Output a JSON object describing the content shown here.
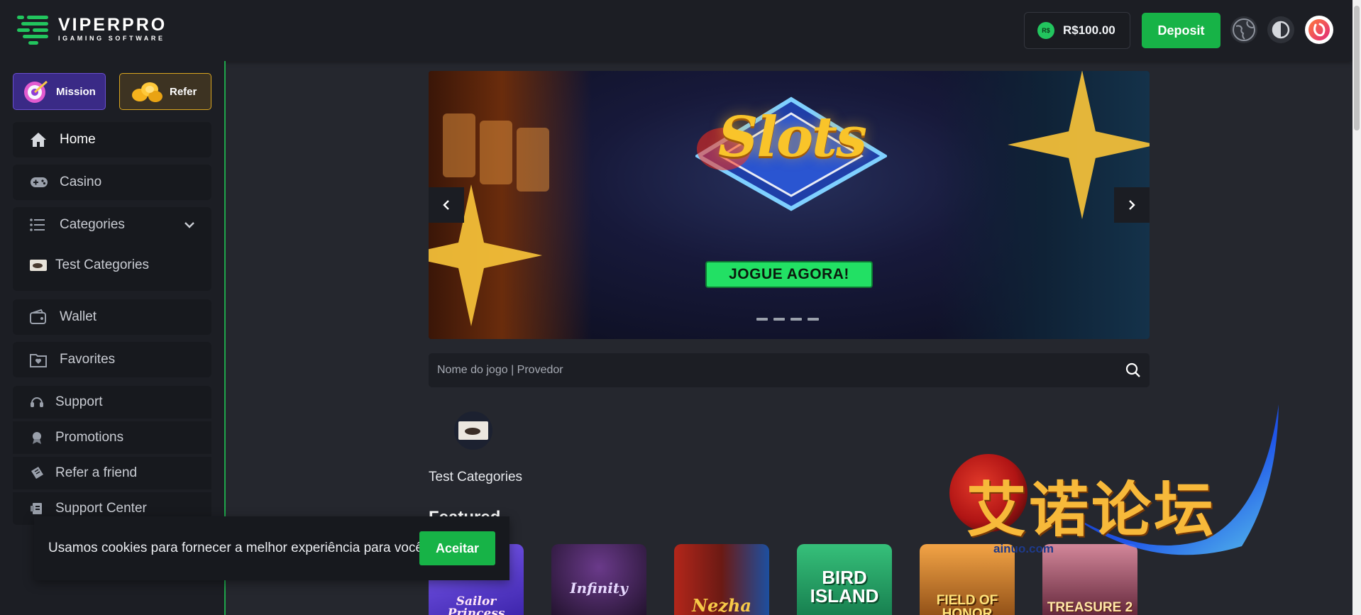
{
  "brand": {
    "name": "VIPERPRO",
    "tagline": "IGAMING SOFTWARE"
  },
  "header": {
    "balance": "R$100.00",
    "currency_badge": "R$",
    "deposit_label": "Deposit",
    "icons": [
      "globe-icon",
      "theme-toggle-icon",
      "user-avatar"
    ]
  },
  "sidebar": {
    "mission_label": "Mission",
    "refer_label": "Refer",
    "items": [
      {
        "label": "Home",
        "icon": "home-icon",
        "active": true
      },
      {
        "label": "Casino",
        "icon": "gamepad-icon"
      },
      {
        "label": "Categories",
        "icon": "list-icon",
        "expanded": true
      },
      {
        "label": "Test Categories",
        "icon": "category-thumb"
      },
      {
        "label": "Wallet",
        "icon": "wallet-icon"
      },
      {
        "label": "Favorites",
        "icon": "favorites-icon"
      },
      {
        "label": "Support",
        "icon": "headset-icon"
      },
      {
        "label": "Promotions",
        "icon": "award-icon"
      },
      {
        "label": "Refer a friend",
        "icon": "ticket-icon"
      },
      {
        "label": "Support Center",
        "icon": "book-icon"
      }
    ]
  },
  "banner": {
    "title": "Slots",
    "cta": "JOGUE AGORA!",
    "slides": 4,
    "active_slide": 1
  },
  "search": {
    "placeholder": "Nome do jogo | Provedor"
  },
  "categories": [
    {
      "label": "Test Categories"
    }
  ],
  "featured": {
    "heading": "Featured",
    "games": [
      {
        "title": "Sailor Princess",
        "color": "#5b3fd6"
      },
      {
        "title": "Infinity",
        "color": "#2a1838"
      },
      {
        "title": "Nezha",
        "color": "#7a1d16"
      },
      {
        "title": "Bird Island",
        "color": "#1d8a5c"
      },
      {
        "title": "Field of Honor",
        "color": "#b8691e"
      },
      {
        "title": "Treasure 2",
        "color": "#6b2a3a"
      }
    ]
  },
  "cookie": {
    "message": "Usamos cookies para fornecer a melhor experiência para você.",
    "accept_label": "Aceitar"
  },
  "watermark": {
    "text": "艾诺论坛",
    "url": "ainuo.com"
  },
  "colors": {
    "accent_green": "#17b347",
    "background": "#25272e",
    "panel": "#1c1e24"
  }
}
